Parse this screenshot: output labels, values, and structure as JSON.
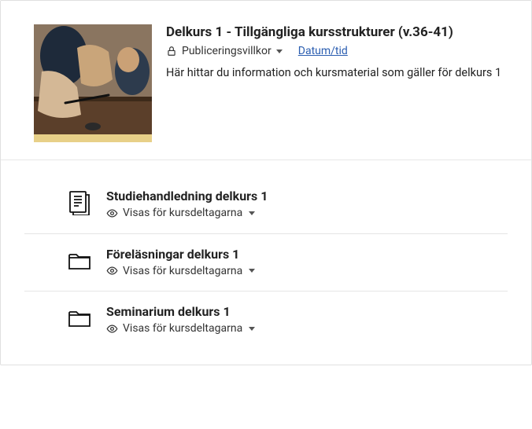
{
  "header": {
    "title": "Delkurs 1 - Tillgängliga kursstrukturer (v.36-41)",
    "publish_label": "Publiceringsvillkor",
    "datetime_link": "Datum/tid",
    "description": "Här hittar du information och kursmaterial som gäller för delkurs 1"
  },
  "items": [
    {
      "icon": "document",
      "title": "Studiehandledning delkurs 1",
      "visibility": "Visas för kursdeltagarna"
    },
    {
      "icon": "folder",
      "title": "Föreläsningar delkurs 1",
      "visibility": "Visas för kursdeltagarna"
    },
    {
      "icon": "folder",
      "title": "Seminarium delkurs 1",
      "visibility": "Visas för kursdeltagarna"
    }
  ]
}
